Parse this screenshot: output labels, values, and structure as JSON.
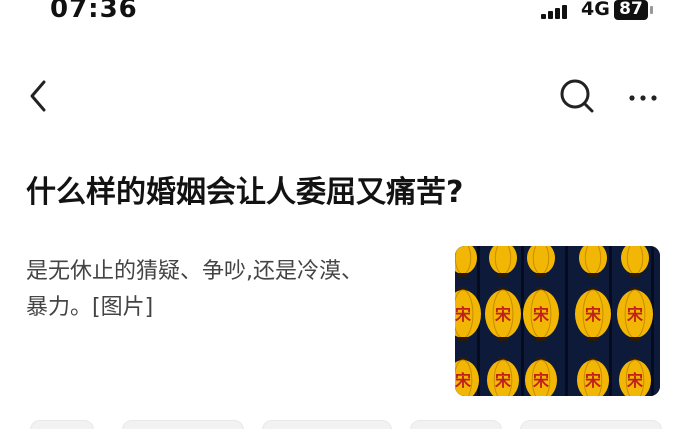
{
  "status_bar": {
    "time": "07:36",
    "network": "4G",
    "battery": "87",
    "signal_icon": "signal-bars-icon"
  },
  "nav": {
    "back_icon": "chevron-left-icon",
    "search_icon": "search-icon",
    "more_icon": "more-horizontal-icon"
  },
  "question": {
    "title": "什么样的婚姻会让人委屈又痛苦?"
  },
  "answer": {
    "excerpt_line1": "是无休止的猜疑、争吵,还是冷漠、",
    "excerpt_line2": "暴力。[图片]",
    "thumbnail_lantern_char": "宋"
  },
  "colors": {
    "text_primary": "#121212",
    "text_secondary": "#444444",
    "lantern": "#f2b705",
    "lantern_dark": "#c98c00",
    "thumbnail_bg": "#0d1a3a"
  }
}
